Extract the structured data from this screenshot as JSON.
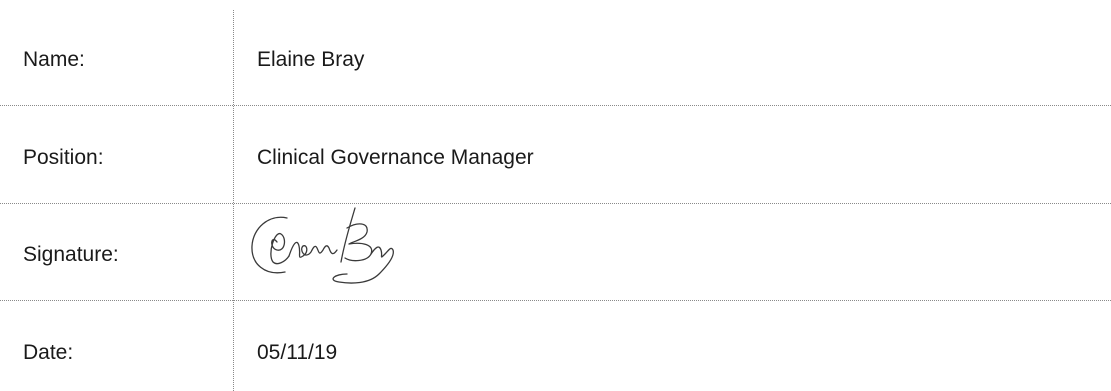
{
  "form": {
    "rows": [
      {
        "label": "Name:",
        "value": "Elaine Bray"
      },
      {
        "label": "Position:",
        "value": "Clinical Governance Manager"
      },
      {
        "label": "Signature:",
        "value": ""
      },
      {
        "label": "Date:",
        "value": "05/11/19"
      }
    ],
    "signature": {
      "text": "Elaine Bray",
      "ink_color": "#3a3a3a"
    },
    "divider_color": "#8a8a8a"
  }
}
